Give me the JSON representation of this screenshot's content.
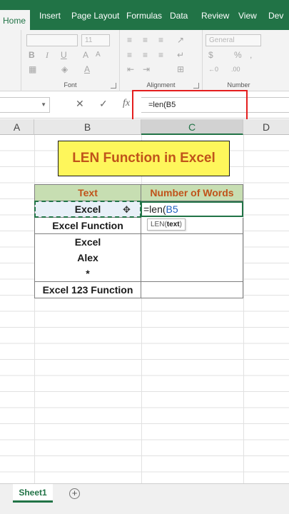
{
  "ribbon": {
    "tabs": [
      "Home",
      "Insert",
      "Page Layout",
      "Formulas",
      "Data",
      "Review",
      "View",
      "Dev"
    ],
    "font_size_value": "11",
    "number_format_value": "General",
    "group_labels": {
      "font": "Font",
      "alignment": "Alignment",
      "number": "Number"
    }
  },
  "formula_bar": {
    "cancel_icon": "✕",
    "enter_icon": "✓",
    "fx_label": "fx",
    "content": "=len(B5"
  },
  "columns": [
    "A",
    "B",
    "C",
    "D"
  ],
  "title": "LEN Function in Excel",
  "table": {
    "headers": [
      "Text",
      "Number of Words"
    ],
    "rows": [
      "Excel",
      "Excel Function",
      "Excel",
      "Alex",
      "*",
      "Excel 123 Function"
    ]
  },
  "editing_cell": {
    "prefix": "=len(",
    "reference": "B5"
  },
  "tooltip": {
    "function": "LEN(",
    "argument": "text",
    "suffix": ")"
  },
  "sheet": {
    "tab": "Sheet1",
    "add_icon": "+"
  },
  "colors": {
    "excel_green": "#217346",
    "title_fill": "#fef65b",
    "title_text": "#c0531a",
    "header_fill": "#c7deb2",
    "highlight": "#e41e1e"
  }
}
